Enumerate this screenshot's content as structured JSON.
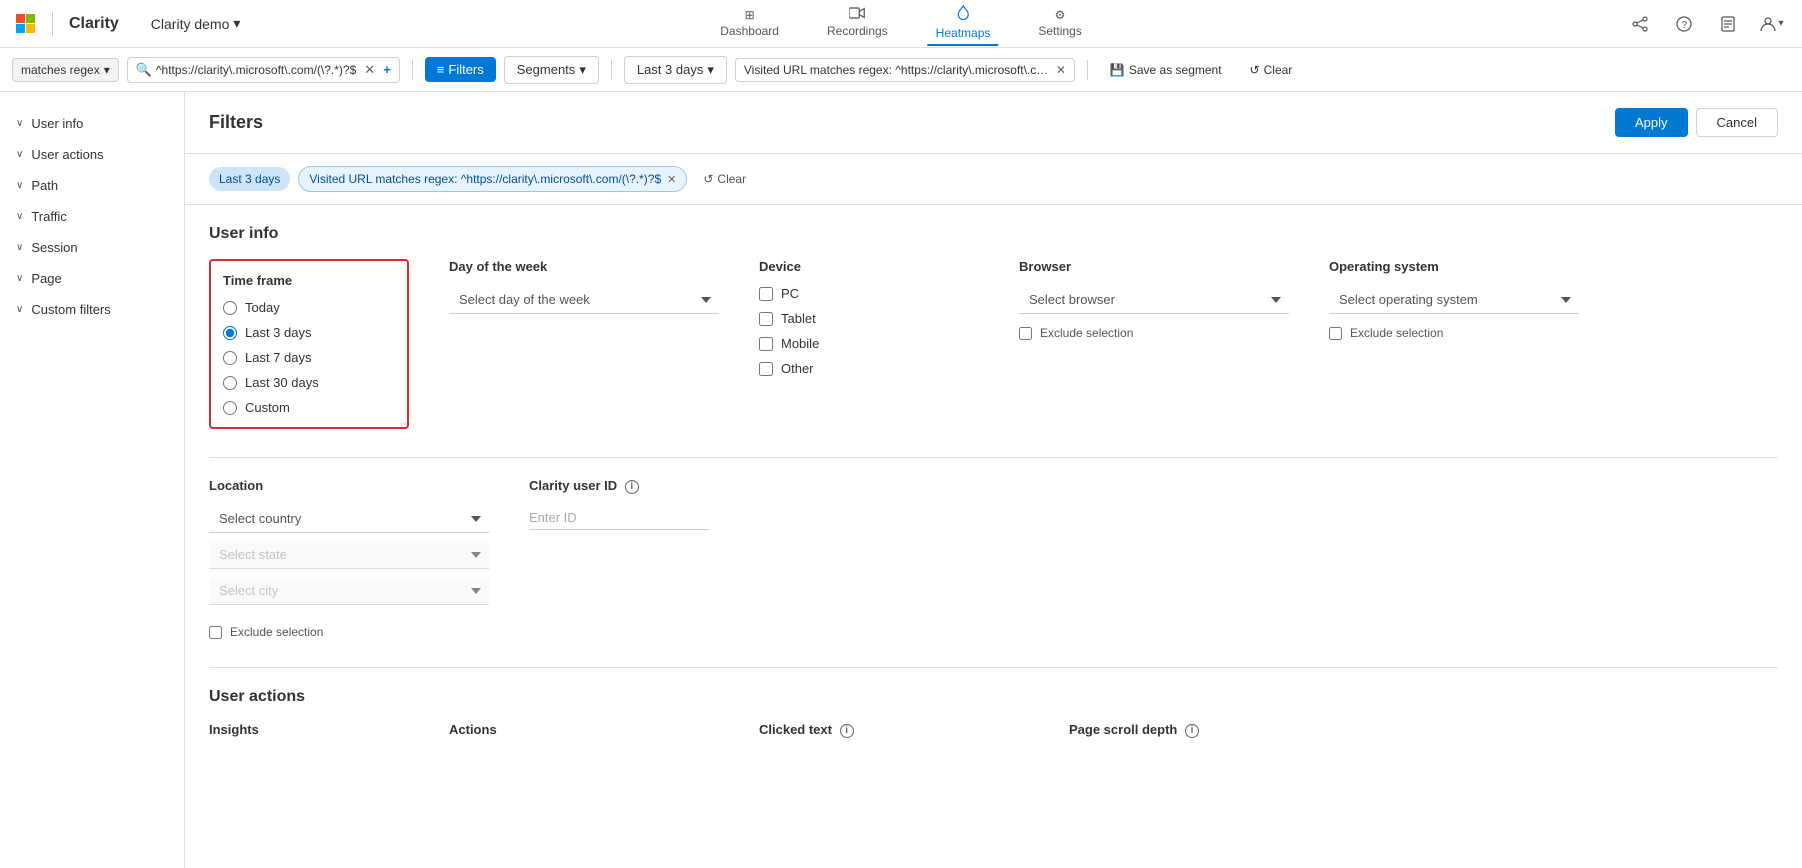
{
  "app": {
    "brand": "Microsoft",
    "product": "Clarity",
    "project_name": "Clarity demo",
    "project_chevron": "▾"
  },
  "nav": {
    "items": [
      {
        "id": "dashboard",
        "label": "Dashboard",
        "icon": "⊞",
        "active": false
      },
      {
        "id": "recordings",
        "label": "Recordings",
        "icon": "🎬",
        "active": false
      },
      {
        "id": "heatmaps",
        "label": "Heatmaps",
        "icon": "🔥",
        "active": true
      },
      {
        "id": "settings",
        "label": "Settings",
        "icon": "⚙",
        "active": false
      }
    ]
  },
  "nav_right": {
    "share_icon": "⇅",
    "help_icon": "?",
    "docs_icon": "📄",
    "account_icon": "👤"
  },
  "filter_bar": {
    "regex_tag": "matches regex",
    "url_value": "^https://clarity\\.microsoft\\.com/(\\?.*)?$",
    "add_icon": "+",
    "filters_label": "Filters",
    "segments_label": "Segments",
    "last3days_label": "Last 3 days",
    "visited_url_label": "Visited URL matches regex: ^https://clarity\\.microsoft\\.com/(\\?.*)?$",
    "save_segment_label": "Save as segment",
    "clear_label": "Clear"
  },
  "panel": {
    "title": "Filters",
    "apply_label": "Apply",
    "cancel_label": "Cancel"
  },
  "chips": {
    "last3days": "Last 3 days",
    "visited_url": "Visited URL matches regex: ^https://clarity\\.microsoft\\.com/(\\?.*)?$",
    "clear_label": "Clear"
  },
  "user_info": {
    "section_title": "User info",
    "time_frame": {
      "label": "Time frame",
      "options": [
        {
          "id": "today",
          "label": "Today",
          "checked": false
        },
        {
          "id": "last3days",
          "label": "Last 3 days",
          "checked": true
        },
        {
          "id": "last7days",
          "label": "Last 7 days",
          "checked": false
        },
        {
          "id": "last30days",
          "label": "Last 30 days",
          "checked": false
        },
        {
          "id": "custom",
          "label": "Custom",
          "checked": false
        }
      ]
    },
    "day_of_week": {
      "label": "Day of the week",
      "placeholder": "Select day of the week"
    },
    "device": {
      "label": "Device",
      "options": [
        {
          "id": "pc",
          "label": "PC",
          "checked": false
        },
        {
          "id": "tablet",
          "label": "Tablet",
          "checked": false
        },
        {
          "id": "mobile",
          "label": "Mobile",
          "checked": false
        },
        {
          "id": "other",
          "label": "Other",
          "checked": false
        }
      ]
    },
    "browser": {
      "label": "Browser",
      "placeholder": "Select browser",
      "exclude_label": "Exclude selection"
    },
    "operating_system": {
      "label": "Operating system",
      "placeholder": "Select operating system",
      "exclude_label": "Exclude selection"
    }
  },
  "location": {
    "label": "Location",
    "country_placeholder": "Select country",
    "state_placeholder": "Select state",
    "city_placeholder": "Select city",
    "exclude_label": "Exclude selection"
  },
  "clarity_user_id": {
    "label": "Clarity user ID",
    "placeholder": "Enter ID"
  },
  "user_actions": {
    "section_title": "User actions",
    "insights_label": "Insights",
    "actions_label": "Actions",
    "clicked_text_label": "Clicked text",
    "page_scroll_depth_label": "Page scroll depth"
  },
  "colors": {
    "accent": "#0078d4",
    "red_border": "#d32f2f",
    "chip_blue_bg": "#cce4f7",
    "chip_blue_text": "#004e8c"
  }
}
